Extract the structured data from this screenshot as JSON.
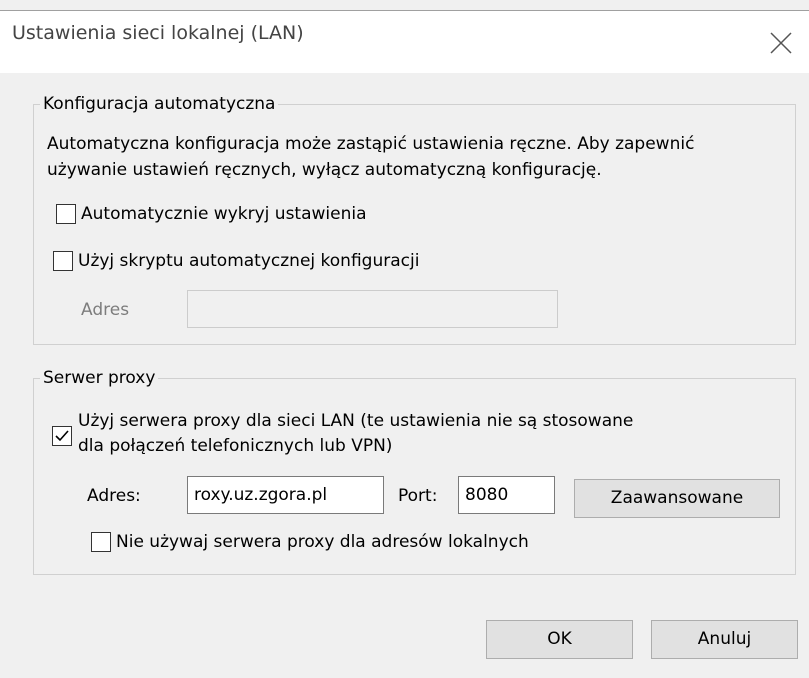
{
  "window": {
    "title": "Ustawienia sieci lokalnej (LAN)"
  },
  "auto_config": {
    "legend": "Konfiguracja automatyczna",
    "description_line1": "Automatyczna konfiguracja może zastąpić ustawienia ręczne. Aby zapewnić",
    "description_line2": "używanie ustawień ręcznych, wyłącz automatyczną konfigurację.",
    "detect_label": "Automatycznie wykryj ustawienia",
    "detect_checked": false,
    "script_label": "Użyj skryptu automatycznej konfiguracji",
    "script_checked": false,
    "address_label": "Adres",
    "address_value": ""
  },
  "proxy": {
    "legend": "Serwer proxy",
    "use_proxy_line1": "Użyj serwera proxy dla sieci LAN (te ustawienia nie są stosowane",
    "use_proxy_line2": "dla połączeń telefonicznych lub VPN)",
    "use_proxy_checked": true,
    "address_label": "Adres:",
    "address_value": "roxy.uz.zgora.pl",
    "port_label": "Port:",
    "port_value": "8080",
    "advanced_label": "Zaawansowane",
    "bypass_local_label": "Nie używaj serwera proxy dla adresów lokalnych",
    "bypass_local_checked": false
  },
  "buttons": {
    "ok": "OK",
    "cancel": "Anuluj"
  }
}
